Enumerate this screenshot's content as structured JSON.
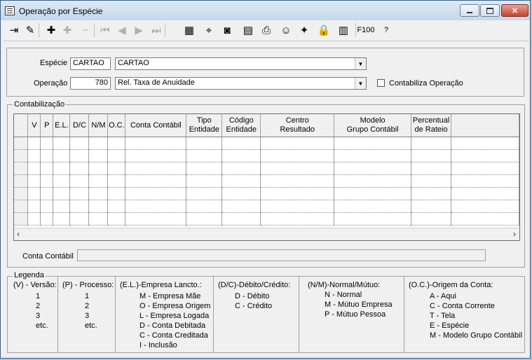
{
  "window": {
    "title": "Operação por Espécie",
    "close_label": "✕"
  },
  "toolbar": {
    "tools": [
      {
        "icon": "exit-icon",
        "glyph": "⇥",
        "enabled": true
      },
      {
        "icon": "edit-icon",
        "glyph": "✎",
        "enabled": true
      },
      {
        "icon": "add-icon",
        "glyph": "✚",
        "enabled": true
      },
      {
        "icon": "add-disabled-icon",
        "glyph": "✚",
        "enabled": false
      },
      {
        "icon": "remove-icon",
        "glyph": "−",
        "enabled": false
      },
      {
        "icon": "first-icon",
        "glyph": "⏮",
        "enabled": false
      },
      {
        "icon": "previous-icon",
        "glyph": "◀",
        "enabled": false
      },
      {
        "icon": "next-icon",
        "glyph": "▶",
        "enabled": false
      },
      {
        "icon": "last-icon",
        "glyph": "⏭",
        "enabled": false
      },
      {
        "icon": "list-icon",
        "glyph": "▦",
        "enabled": true
      },
      {
        "icon": "binoculars-icon",
        "glyph": "⌖",
        "enabled": true
      },
      {
        "icon": "camera-icon",
        "glyph": "◙",
        "enabled": true
      },
      {
        "icon": "calendar-icon",
        "glyph": "▤",
        "enabled": true
      },
      {
        "icon": "print-icon",
        "glyph": "⎙",
        "enabled": true
      },
      {
        "icon": "user-icon",
        "glyph": "☺",
        "enabled": true
      },
      {
        "icon": "sparkle-icon",
        "glyph": "✦",
        "enabled": true
      },
      {
        "icon": "lock-icon",
        "glyph": "🔒",
        "enabled": true
      },
      {
        "icon": "book-icon",
        "glyph": "▥",
        "enabled": true
      }
    ],
    "f100_label": "F100",
    "help_label": "?"
  },
  "form": {
    "especie_label": "Espécie",
    "especie_code": "CARTAO",
    "especie_name": "CARTAO",
    "operacao_label": "Operação",
    "operacao_code": "780",
    "operacao_name": "Rel. Taxa de Anuidade",
    "contabiliza_label": "Contabiliza Operação"
  },
  "contabilizacao": {
    "title": "Contabilização",
    "columns": [
      "V",
      "P",
      "E.L.",
      "D/C",
      "N/M",
      "O.C.",
      "Conta Contábil",
      "Tipo\nEntidade",
      "Código\nEntidade",
      "Centro\nResultado",
      "Modelo\nGrupo Contábil",
      "Percentual\nde Rateio"
    ],
    "rows": 7
  },
  "conta_contabil_label": "Conta Contábil",
  "legenda": {
    "title": "Legenda",
    "columns": [
      {
        "head": "(V) - Versão:",
        "items": [
          "1",
          "2",
          "3",
          "etc."
        ]
      },
      {
        "head": "(P) - Processo:",
        "items": [
          "1",
          "2",
          "3",
          "etc."
        ]
      },
      {
        "head": "(E.L.)-Empresa Lancto.:",
        "items": [
          "M - Empresa Mãe",
          "O - Empresa Origem",
          "L - Empresa Logada",
          "D - Conta Debitada",
          "C - Conta Creditada",
          "I - Inclusão"
        ]
      },
      {
        "head": "(D/C)-Débito/Crédito:",
        "items": [
          "D - Débito",
          "C - Crédito"
        ]
      },
      {
        "head": "(N/M)-Normal/Mútuo:",
        "items": [
          "N - Normal",
          "M - Mútuo Empresa",
          "P - Mútuo Pessoa"
        ]
      },
      {
        "head": "(O.C.)-Origem da Conta:",
        "items": [
          "A - Aqui",
          "C - Conta Corrente",
          "T - Tela",
          "E - Espécie",
          "M - Modelo Grupo Contábil"
        ]
      }
    ]
  }
}
